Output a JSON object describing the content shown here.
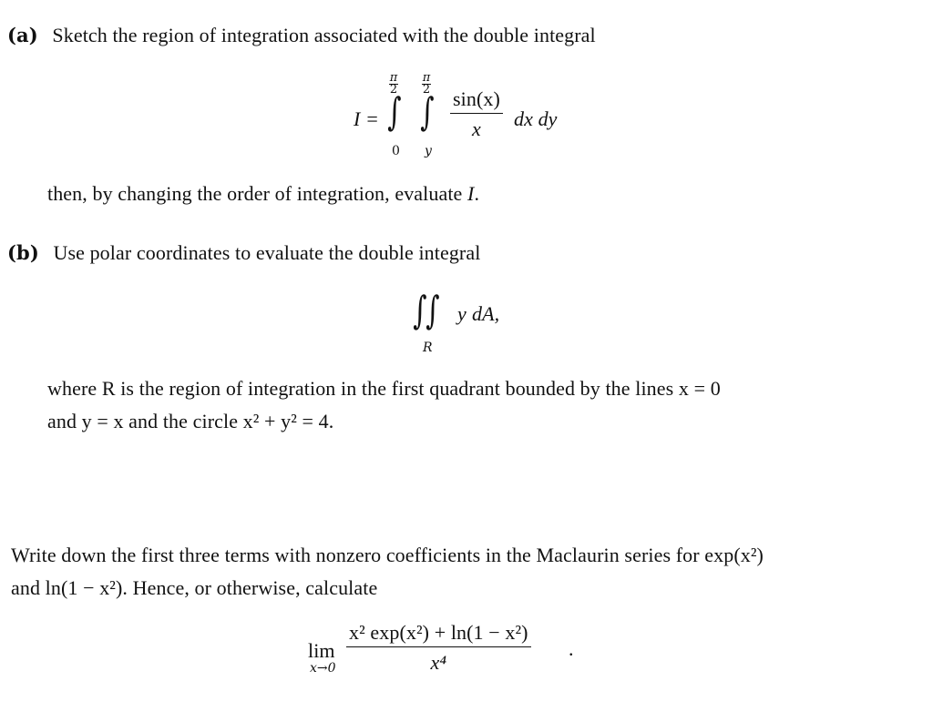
{
  "part_a": {
    "label": "(a)",
    "line1": "Sketch the region of integration associated with the double integral",
    "integral": {
      "lhs": "I =",
      "outer_upper": "π/2",
      "outer_upper_num": "π",
      "outer_upper_den": "2",
      "outer_lower": "0",
      "inner_upper_num": "π",
      "inner_upper_den": "2",
      "inner_lower": "y",
      "integrand_num": "sin(x)",
      "integrand_den": "x",
      "differentials": "dx dy"
    },
    "line2_pre": "then, by changing the order of integration, evaluate",
    "line2_var": "I",
    "line2_post": "."
  },
  "part_b": {
    "label": "(b)",
    "line1": "Use polar coordinates to evaluate the double integral",
    "integral": {
      "region": "R",
      "integrand": "y",
      "differential": "dA,"
    },
    "line2": "where R is the region of integration in the first quadrant bounded by the lines x = 0",
    "line3": "and y = x and the circle x² + y² = 4."
  },
  "part_c": {
    "line1": "Write down the first three terms with nonzero coefficients in the Maclaurin series for exp(x²)",
    "line2": "and ln(1 − x²). Hence, or otherwise, calculate",
    "limit": {
      "op": "lim",
      "sub": "x→0",
      "numerator": "x² exp(x²) + ln(1 − x²)",
      "denominator": "x⁴",
      "trail": "."
    }
  }
}
